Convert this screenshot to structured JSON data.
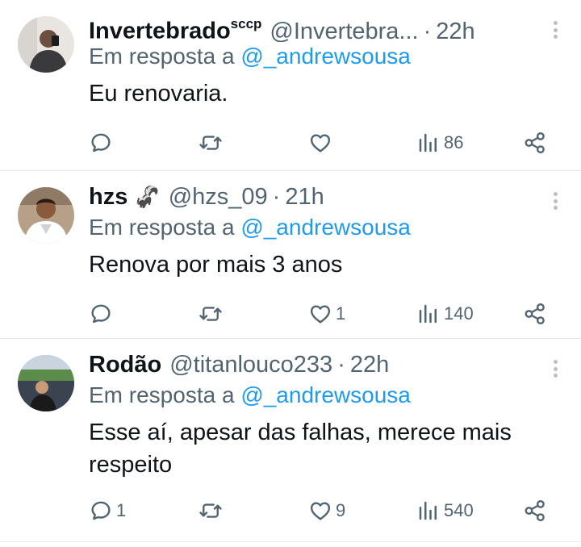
{
  "colors": {
    "text": "#0f1419",
    "secondary": "#536471",
    "link": "#1d9bf0",
    "divider": "#e6e9ec"
  },
  "tweets": [
    {
      "name": "Invertebrado",
      "name_suffix": "sccp",
      "emoji": "",
      "handle": "@Invertebra...",
      "separator": "·",
      "time": "22h",
      "reply_prefix": "Em resposta a ",
      "reply_to": "@_andrewsousa",
      "text": "Eu renovaria.",
      "replies": "",
      "retweets": "",
      "likes": "",
      "views": "86"
    },
    {
      "name": "hzs",
      "name_suffix": "",
      "emoji": "🦨",
      "handle": "@hzs_09",
      "separator": "·",
      "time": "21h",
      "reply_prefix": "Em resposta a ",
      "reply_to": "@_andrewsousa",
      "text": "Renova por mais 3 anos",
      "replies": "",
      "retweets": "",
      "likes": "1",
      "views": "140"
    },
    {
      "name": "Rodão",
      "name_suffix": "",
      "emoji": "",
      "handle": "@titanlouco233",
      "separator": "·",
      "time": "22h",
      "reply_prefix": "Em resposta a ",
      "reply_to": "@_andrewsousa",
      "text": "Esse aí, apesar das falhas, merece mais respeito",
      "replies": "1",
      "retweets": "",
      "likes": "9",
      "views": "540"
    }
  ]
}
